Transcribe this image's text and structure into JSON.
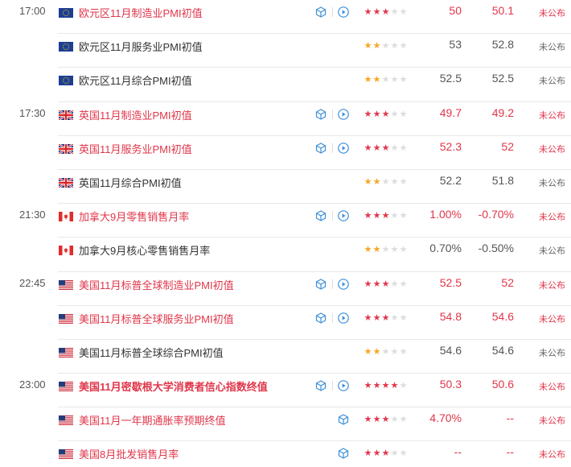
{
  "colors": {
    "highlight": "#e0364a",
    "gold_star": "#f5a623",
    "grey_star": "#dcdcdc",
    "separator": "#e8e8e8"
  },
  "rows": [
    {
      "time": "17:00",
      "flag": "eu",
      "name": "欧元区11月制造业PMI初值",
      "stars": 3,
      "previous": "50",
      "forecast": "50.1",
      "status": "未公布",
      "hl": true,
      "icons": "cube-play"
    },
    {
      "time": "",
      "flag": "eu",
      "name": "欧元区11月服务业PMI初值",
      "stars": 2,
      "previous": "53",
      "forecast": "52.8",
      "status": "未公布",
      "hl": false,
      "icons": "none"
    },
    {
      "time": "",
      "flag": "eu",
      "name": "欧元区11月综合PMI初值",
      "stars": 2,
      "previous": "52.5",
      "forecast": "52.5",
      "status": "未公布",
      "hl": false,
      "icons": "none"
    },
    {
      "time": "17:30",
      "flag": "uk",
      "name": "英国11月制造业PMI初值",
      "stars": 3,
      "previous": "49.7",
      "forecast": "49.2",
      "status": "未公布",
      "hl": true,
      "icons": "cube-play"
    },
    {
      "time": "",
      "flag": "uk",
      "name": "英国11月服务业PMI初值",
      "stars": 3,
      "previous": "52.3",
      "forecast": "52",
      "status": "未公布",
      "hl": true,
      "icons": "cube-play"
    },
    {
      "time": "",
      "flag": "uk",
      "name": "英国11月综合PMI初值",
      "stars": 2,
      "previous": "52.2",
      "forecast": "51.8",
      "status": "未公布",
      "hl": false,
      "icons": "none"
    },
    {
      "time": "21:30",
      "flag": "ca",
      "name": "加拿大9月零售销售月率",
      "stars": 3,
      "previous": "1.00%",
      "forecast": "-0.70%",
      "status": "未公布",
      "hl": true,
      "icons": "cube-play"
    },
    {
      "time": "",
      "flag": "ca",
      "name": "加拿大9月核心零售销售月率",
      "stars": 2,
      "previous": "0.70%",
      "forecast": "-0.50%",
      "status": "未公布",
      "hl": false,
      "icons": "none"
    },
    {
      "time": "22:45",
      "flag": "us",
      "name": "美国11月标普全球制造业PMI初值",
      "stars": 3,
      "previous": "52.5",
      "forecast": "52",
      "status": "未公布",
      "hl": true,
      "icons": "cube-play"
    },
    {
      "time": "",
      "flag": "us",
      "name": "美国11月标普全球服务业PMI初值",
      "stars": 3,
      "previous": "54.8",
      "forecast": "54.6",
      "status": "未公布",
      "hl": true,
      "icons": "cube-play"
    },
    {
      "time": "",
      "flag": "us",
      "name": "美国11月标普全球综合PMI初值",
      "stars": 2,
      "previous": "54.6",
      "forecast": "54.6",
      "status": "未公布",
      "hl": false,
      "icons": "none"
    },
    {
      "time": "23:00",
      "flag": "us",
      "name": "美国11月密歇根大学消费者信心指数终值",
      "stars": 4,
      "previous": "50.3",
      "forecast": "50.6",
      "status": "未公布",
      "hl": true,
      "bold": true,
      "icons": "cube-play"
    },
    {
      "time": "",
      "flag": "us",
      "name": "美国11月一年期通胀率预期终值",
      "stars": 3,
      "previous": "4.70%",
      "forecast": "--",
      "status": "未公布",
      "hl": true,
      "icons": "cube"
    },
    {
      "time": "",
      "flag": "us",
      "name": "美国8月批发销售月率",
      "stars": 3,
      "previous": "--",
      "forecast": "--",
      "status": "未公布",
      "hl": true,
      "icons": "cube"
    }
  ]
}
